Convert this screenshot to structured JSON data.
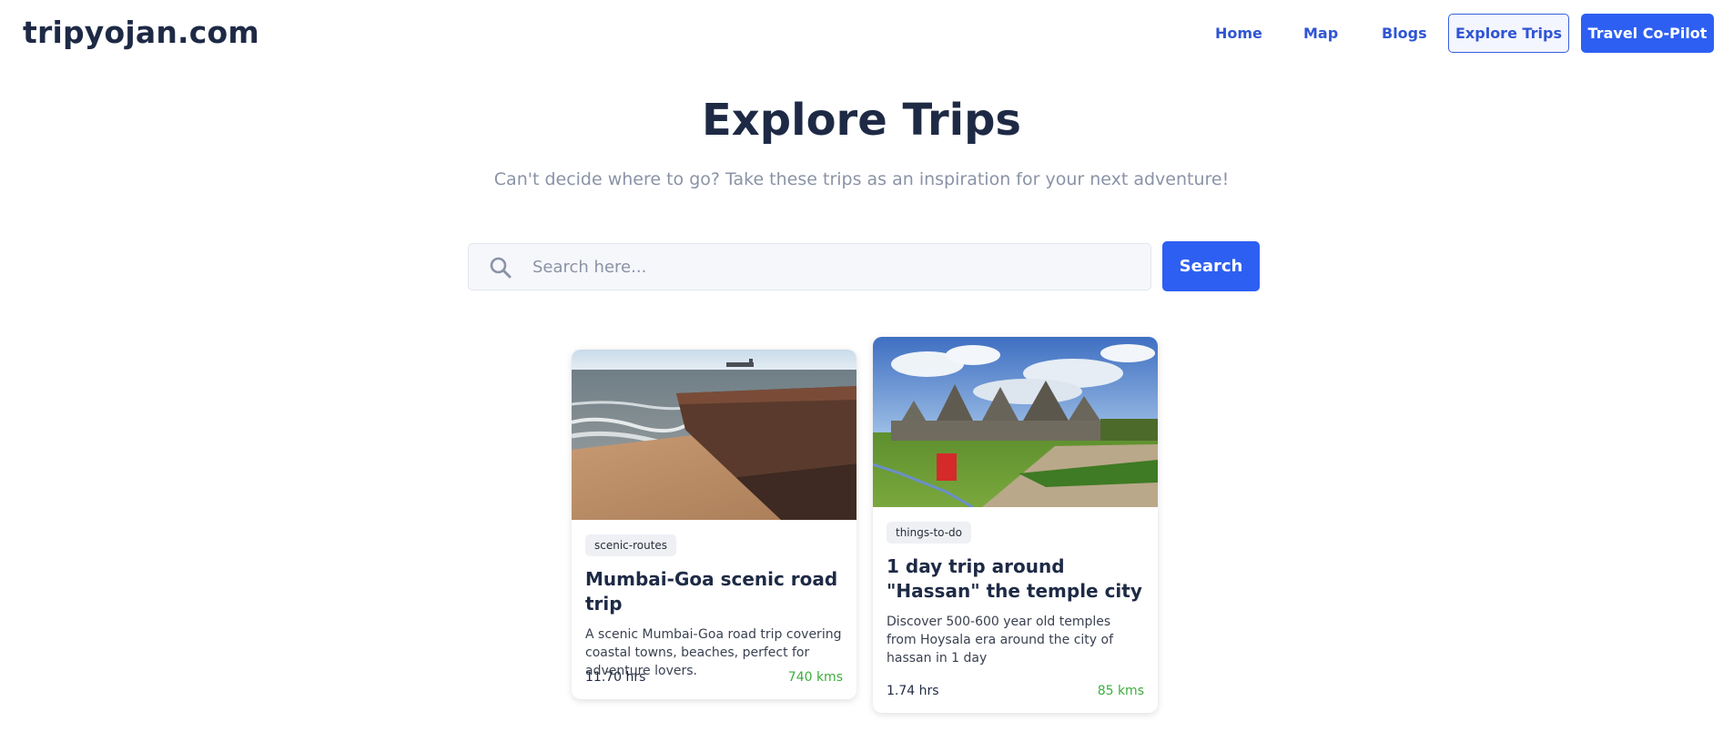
{
  "header": {
    "logo": "tripyojan.com",
    "nav": {
      "home": "Home",
      "map": "Map",
      "blogs": "Blogs",
      "explore": "Explore Trips",
      "copilot": "Travel Co-Pilot"
    }
  },
  "hero": {
    "title": "Explore Trips",
    "subtitle": "Can't decide where to go? Take these trips as an inspiration for your next adventure!"
  },
  "search": {
    "placeholder": "Search here...",
    "button": "Search",
    "icon": "search-icon"
  },
  "trips": [
    {
      "tag": "scenic-routes",
      "title": "Mumbai-Goa scenic road trip",
      "description": "A scenic Mumbai-Goa road trip covering coastal towns, beaches, perfect for adventure lovers.",
      "duration": "11.70 hrs",
      "distance": "740 kms"
    },
    {
      "tag": "things-to-do",
      "title": "1 day trip around \"Hassan\" the temple city",
      "description": "Discover 500-600 year old temples from Hoysala era around the city of hassan in 1 day",
      "duration": "1.74 hrs",
      "distance": "85 kms"
    }
  ],
  "colors": {
    "accent": "#2d5ff2",
    "heading": "#1e2a45",
    "distance": "#3cae3c"
  }
}
